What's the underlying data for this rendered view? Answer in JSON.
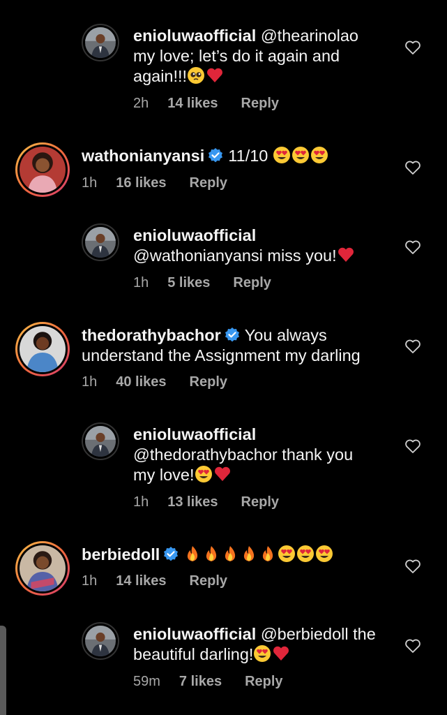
{
  "comments": [
    {
      "username": "enioluwaofficial",
      "verified": false,
      "text_lines": [
        "@thearinolao",
        "my love; let’s do it again and",
        "again!!!"
      ],
      "emojis": [
        "pleading-face-emoji",
        "red-heart-emoji"
      ],
      "time": "2h",
      "likes": "14 likes",
      "reply": "Reply"
    },
    {
      "username": "wathonianyansi",
      "verified": true,
      "text_lines": [
        "11/10"
      ],
      "emojis": [
        "heart-eyes-emoji",
        "heart-eyes-emoji",
        "heart-eyes-emoji"
      ],
      "time": "1h",
      "likes": "16 likes",
      "reply": "Reply"
    },
    {
      "username": "enioluwaofficial",
      "verified": false,
      "text_lines": [
        "@wathonianyansi miss you!"
      ],
      "emojis": [
        "red-heart-emoji"
      ],
      "time": "1h",
      "likes": "5 likes",
      "reply": "Reply"
    },
    {
      "username": "thedorathybachor",
      "verified": true,
      "text_lines": [
        "You always",
        "understand the Assignment my darling"
      ],
      "emojis": [],
      "time": "1h",
      "likes": "40 likes",
      "reply": "Reply"
    },
    {
      "username": "enioluwaofficial",
      "verified": false,
      "text_lines": [
        "@thedorathybachor thank you",
        "my love!"
      ],
      "emojis": [
        "heart-eyes-emoji",
        "red-heart-emoji"
      ],
      "time": "1h",
      "likes": "13 likes",
      "reply": "Reply"
    },
    {
      "username": "berbiedoll",
      "verified": true,
      "text_lines": [
        ""
      ],
      "emojis": [
        "fire-emoji",
        "fire-emoji",
        "fire-emoji",
        "fire-emoji",
        "fire-emoji",
        "heart-eyes-emoji",
        "heart-eyes-emoji",
        "heart-eyes-emoji"
      ],
      "time": "1h",
      "likes": "14 likes",
      "reply": "Reply"
    },
    {
      "username": "enioluwaofficial",
      "verified": false,
      "text_lines": [
        "@berbiedoll the",
        "beautiful darling!"
      ],
      "emojis": [
        "heart-eyes-emoji",
        "red-heart-emoji"
      ],
      "time": "59m",
      "likes": "7 likes",
      "reply": "Reply"
    }
  ],
  "icons": {
    "like": "heart-outline-icon",
    "verified": "verified-badge-icon"
  },
  "colors": {
    "background": "#000000",
    "text": "#f5f5f5",
    "meta": "#a8a8a8",
    "verified": "#3897f0",
    "heart": "#e0263a"
  }
}
